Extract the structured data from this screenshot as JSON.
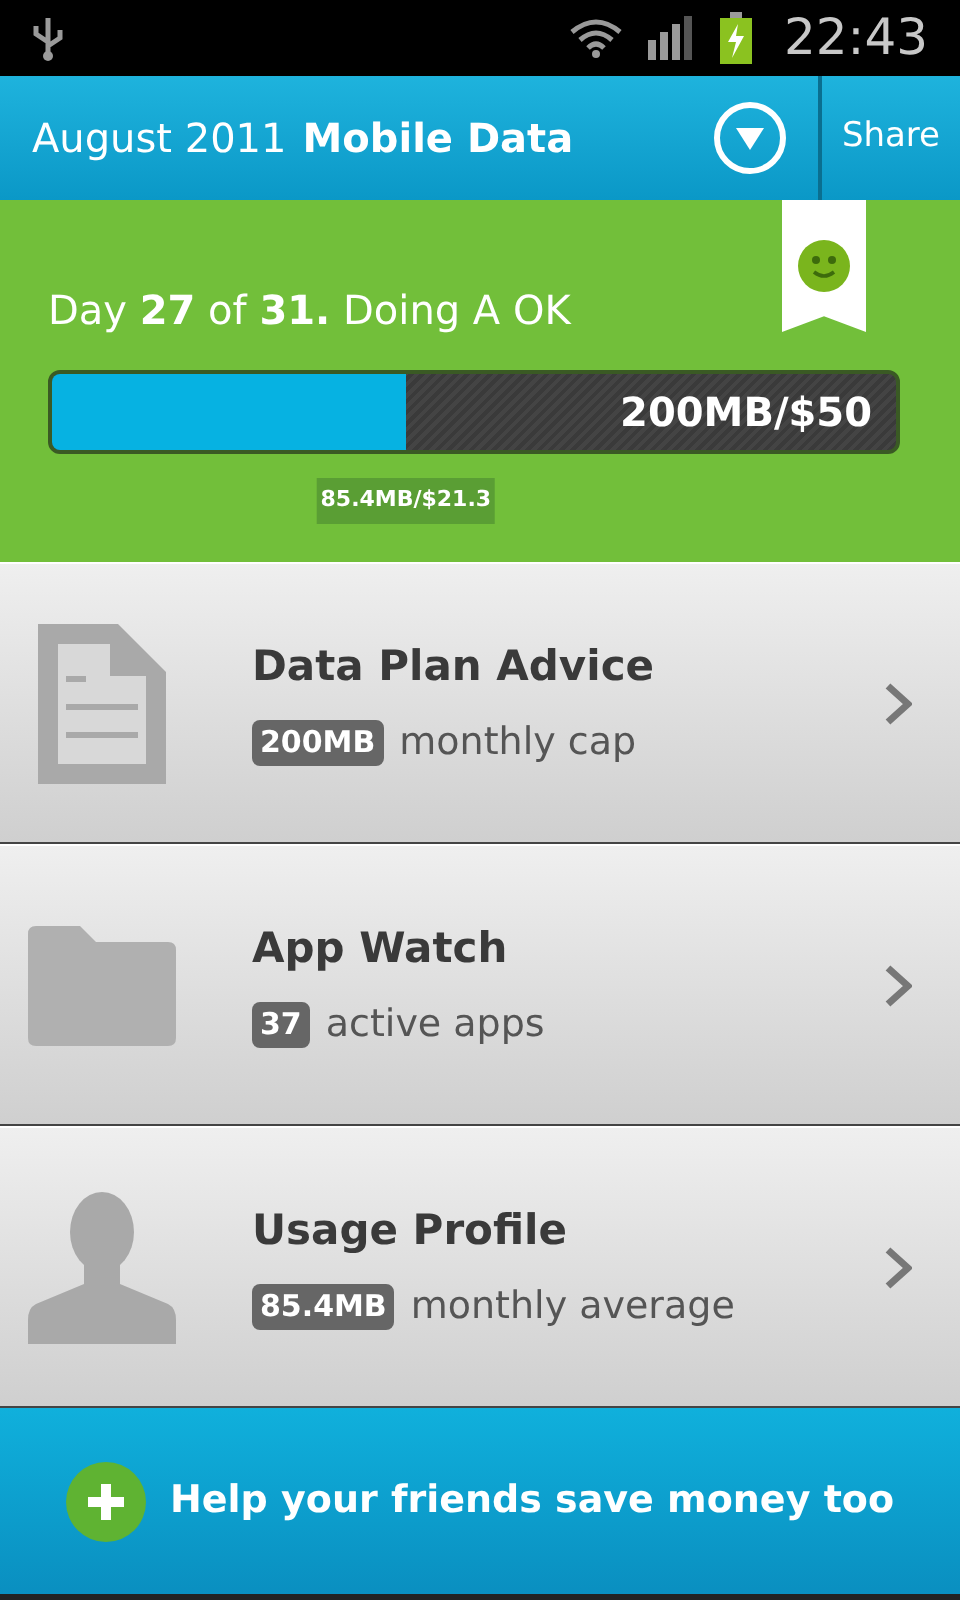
{
  "status_bar": {
    "time": "22:43",
    "battery_charging": true
  },
  "header": {
    "month": "August 2011",
    "title": "Mobile Data",
    "action": "Share"
  },
  "summary": {
    "text": "Day **27** of **31.** Doing A OK",
    "happy": true,
    "usage": {
      "level": 0.42,
      "limit": "200MB/$50",
      "used": "85.4MB/$21.3"
    }
  },
  "items": [
    {
      "kind": "document",
      "title": "Data Plan Advice",
      "badge": "200MB",
      "caption": "monthly cap"
    },
    {
      "kind": "folder",
      "title": "App Watch",
      "badge": "37",
      "caption": "active apps"
    },
    {
      "kind": "person",
      "title": "Usage Profile",
      "badge": "85.4MB",
      "caption": "monthly average"
    }
  ],
  "footer": {
    "label": "Help your friends save money too"
  }
}
